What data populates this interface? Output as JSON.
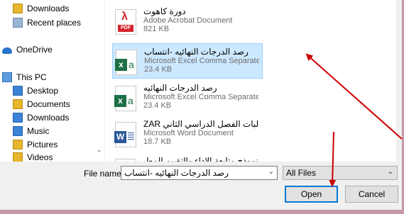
{
  "nav": {
    "items": [
      {
        "label": "Downloads",
        "icon": "downloads-folder-icon"
      },
      {
        "label": "Recent places",
        "icon": "recent-places-icon"
      },
      {
        "label": "OneDrive",
        "icon": "onedrive-cloud-icon"
      },
      {
        "label": "This PC",
        "icon": "computer-icon"
      },
      {
        "label": "Desktop",
        "icon": "desktop-folder-icon"
      },
      {
        "label": "Documents",
        "icon": "documents-folder-icon"
      },
      {
        "label": "Downloads",
        "icon": "downloads-folder-icon"
      },
      {
        "label": "Music",
        "icon": "music-folder-icon"
      },
      {
        "label": "Pictures",
        "icon": "pictures-folder-icon"
      },
      {
        "label": "Videos",
        "icon": "videos-folder-icon"
      }
    ]
  },
  "files": [
    {
      "name": "دورة كاهوت",
      "type": "Adobe Acrobat Document",
      "size": "821 KB",
      "icon": "pdf-icon",
      "selected": false
    },
    {
      "name": "رصد الدرجات النهائيه -انتساب",
      "type": "Microsoft Excel Comma Separate...",
      "size": "23.4 KB",
      "icon": "excel-csv-icon",
      "selected": true
    },
    {
      "name": "رصد الدرجات النهائيه",
      "type": "Microsoft Excel Comma Separate...",
      "size": "23.4 KB",
      "icon": "excel-csv-icon",
      "selected": false
    },
    {
      "name": "ZAR طالبات الفصل الدراسي الثاني",
      "type": "Microsoft Word Document",
      "size": "18.7 KB",
      "icon": "word-doc-icon",
      "selected": false
    }
  ],
  "partial_file": {
    "name": "نموذج متابعة الاداء والتقييم المطبقة"
  },
  "bottom": {
    "file_name_label": "File name:",
    "file_name_value": "رصد الدرجات النهائيه -انتساب",
    "filter_value": "All Files",
    "open_label": "Open",
    "cancel_label": "Cancel"
  },
  "colors": {
    "selection": "#cce8ff",
    "annotation_arrow": "#cc0000",
    "page_background": "#c897a9"
  }
}
